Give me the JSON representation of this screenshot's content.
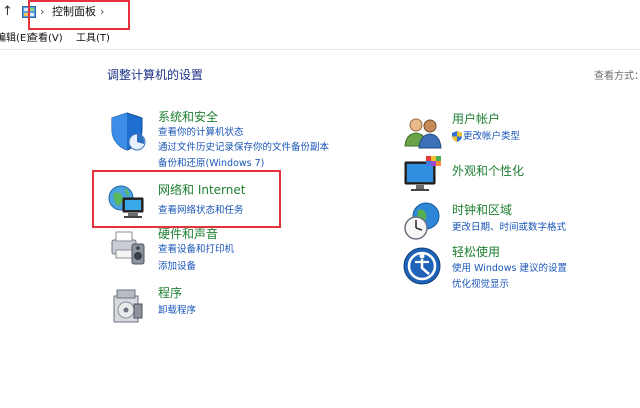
{
  "addressbar": {
    "up_arrow": "↑",
    "sep1": "›",
    "crumb": "控制面板",
    "sep2": "›"
  },
  "menubar": {
    "edit": "编辑(E)",
    "view": "查看(V)",
    "tools": "工具(T)"
  },
  "main": {
    "heading": "调整计算机的设置",
    "view_by": "查看方式："
  },
  "left_categories": [
    {
      "title": "系统和安全",
      "links": [
        "查看你的计算机状态",
        "通过文件历史记录保存你的文件备份副本",
        "备份和还原(Windows 7)"
      ]
    },
    {
      "title": "网络和 Internet",
      "links": [
        "查看网络状态和任务"
      ]
    },
    {
      "title": "硬件和声音",
      "links": [
        "查看设备和打印机",
        "添加设备"
      ]
    },
    {
      "title": "程序",
      "links": [
        "卸载程序"
      ]
    }
  ],
  "right_categories": [
    {
      "title": "用户帐户",
      "links": [
        "更改帐户类型"
      ]
    },
    {
      "title": "外观和个性化",
      "links": []
    },
    {
      "title": "时钟和区域",
      "links": [
        "更改日期、时间或数字格式"
      ]
    },
    {
      "title": "轻松使用",
      "links": [
        "使用 Windows 建议的设置",
        "优化视觉显示"
      ]
    }
  ],
  "colors": {
    "title_green": "#1e7f32",
    "link_blue": "#1a56b8",
    "heading_blue": "#1e3287",
    "highlight_red": "#e3323b"
  },
  "icons": [
    "up-arrow-icon",
    "control-panel-icon",
    "shield-icon",
    "network-globe-icon",
    "printer-speaker-icon",
    "programs-icon",
    "users-icon",
    "uac-shield-icon",
    "monitor-palette-icon",
    "clock-globe-icon",
    "accessibility-icon"
  ]
}
